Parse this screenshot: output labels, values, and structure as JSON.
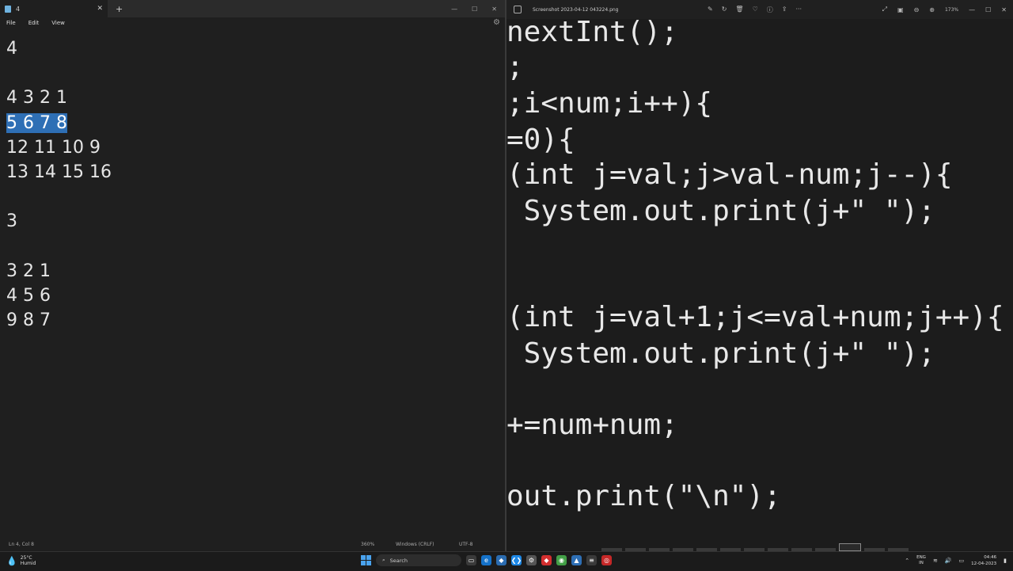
{
  "notepad": {
    "tab_title": "4",
    "menu": [
      "File",
      "Edit",
      "View"
    ],
    "lines": [
      "4",
      "",
      "4 3 2 1",
      "5 6 7 8",
      "12 11 10 9",
      "13 14 15 16",
      "",
      "3",
      "",
      "3 2 1",
      "4 5 6",
      "9 8 7"
    ],
    "selected_line_index": 3,
    "status": {
      "position": "Ln 4, Col 8",
      "zoom": "360%",
      "line_ending": "Windows (CRLF)",
      "encoding": "UTF-8"
    }
  },
  "viewer": {
    "title": "Screenshot 2023-04-12 043224.png",
    "zoom": "173%",
    "code_lines": [
      "nextInt();",
      ";",
      ";i<num;i++){",
      "=0){",
      "(int j=val;j>val-num;j--){",
      " System.out.print(j+\" \");",
      "(int j=val+1;j<=val+num;j++){",
      " System.out.print(j+\" \");",
      "+=num+num;",
      "out.print(\"\\n\");"
    ]
  },
  "taskbar": {
    "temperature": "25°C",
    "condition": "Humid",
    "search_label": "Search",
    "lang": "ENG",
    "region": "IN",
    "time": "04:46",
    "date": "12-04-2023"
  },
  "colors": {
    "selection": "#2e6fb5",
    "background": "#1f1f1f",
    "windows_accent": "#4aa3ee"
  }
}
